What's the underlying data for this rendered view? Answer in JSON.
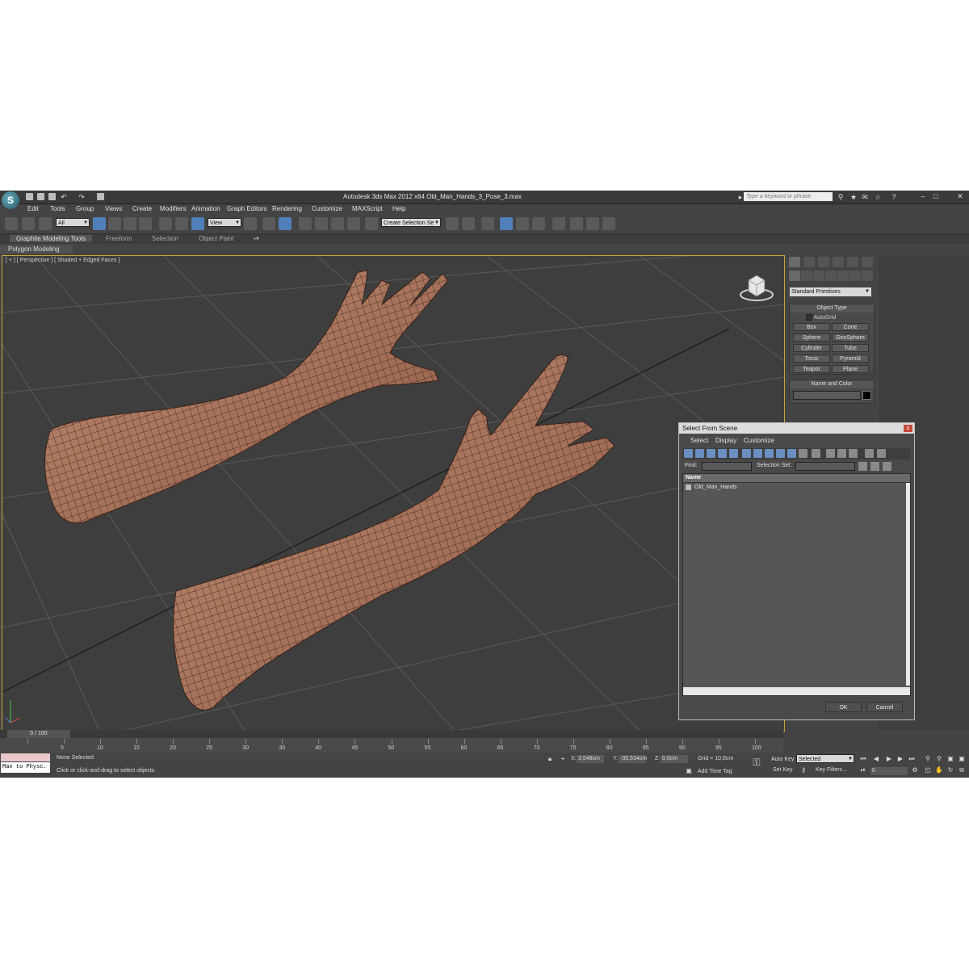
{
  "window": {
    "title": "Autodesk 3ds Max  2012 x64     Old_Man_Hands_3_Pose_3.max",
    "search_placeholder": "Type a keyword or phrase"
  },
  "menu": [
    "Edit",
    "Tools",
    "Group",
    "Views",
    "Create",
    "Modifiers",
    "Animation",
    "Graph Editors",
    "Rendering",
    "Customize",
    "MAXScript",
    "Help"
  ],
  "toolbar": {
    "selection_filter": "All",
    "reference_coord": "View",
    "named_selection": "Create Selection Se"
  },
  "ribbon": {
    "tabs": [
      "Graphite Modeling Tools",
      "Freeform",
      "Selection",
      "Object Paint"
    ],
    "panel": "Polygon Modeling"
  },
  "viewport": {
    "label": "[ + ] [ Perspective ] [ Shaded + Edged Faces ]"
  },
  "command_panel": {
    "category": "Standard Primitives",
    "object_type_title": "Object Type",
    "autogrid": "AutoGrid",
    "primitives": [
      "Box",
      "Cone",
      "Sphere",
      "GeoSphere",
      "Cylinder",
      "Tube",
      "Torus",
      "Pyramid",
      "Teapot",
      "Plane"
    ],
    "name_color_title": "Name and Color"
  },
  "dialog": {
    "title": "Select From Scene",
    "close": "x",
    "menu": [
      "Select",
      "Display",
      "Customize"
    ],
    "find_label": "Find:",
    "selection_set_label": "Selection Set:",
    "column_name": "Name",
    "rows": [
      "Old_Man_Hands"
    ],
    "ok": "OK",
    "cancel": "Cancel"
  },
  "timeline": {
    "frame_display": "0 / 100",
    "ticks": [
      "0",
      "5",
      "10",
      "15",
      "20",
      "25",
      "30",
      "35",
      "40",
      "45",
      "50",
      "55",
      "60",
      "65",
      "70",
      "75",
      "80",
      "85",
      "90",
      "95",
      "100"
    ]
  },
  "status": {
    "maxscript_text": "Max to Physc.",
    "selection": "None Selected",
    "prompt": "Click or click-and-drag to select objects",
    "x_label": "X:",
    "x_value": "3,548cm",
    "y_label": "Y:",
    "y_value": "-35,534cm",
    "z_label": "Z:",
    "z_value": "0,0cm",
    "grid": "Grid = 10,0cm",
    "add_time_tag": "Add Time Tag",
    "auto_key": "Auto Key",
    "auto_key_mode": "Selected",
    "set_key": "Set Key",
    "key_filters": "Key Filters...",
    "current_frame": "0"
  },
  "colors": {
    "ui_bg": "#444444",
    "viewport_bg": "#3e3e3e",
    "viewport_border": "#c8a43a",
    "skin": "#b07a62",
    "selection_blue": "#4f7fb8"
  }
}
